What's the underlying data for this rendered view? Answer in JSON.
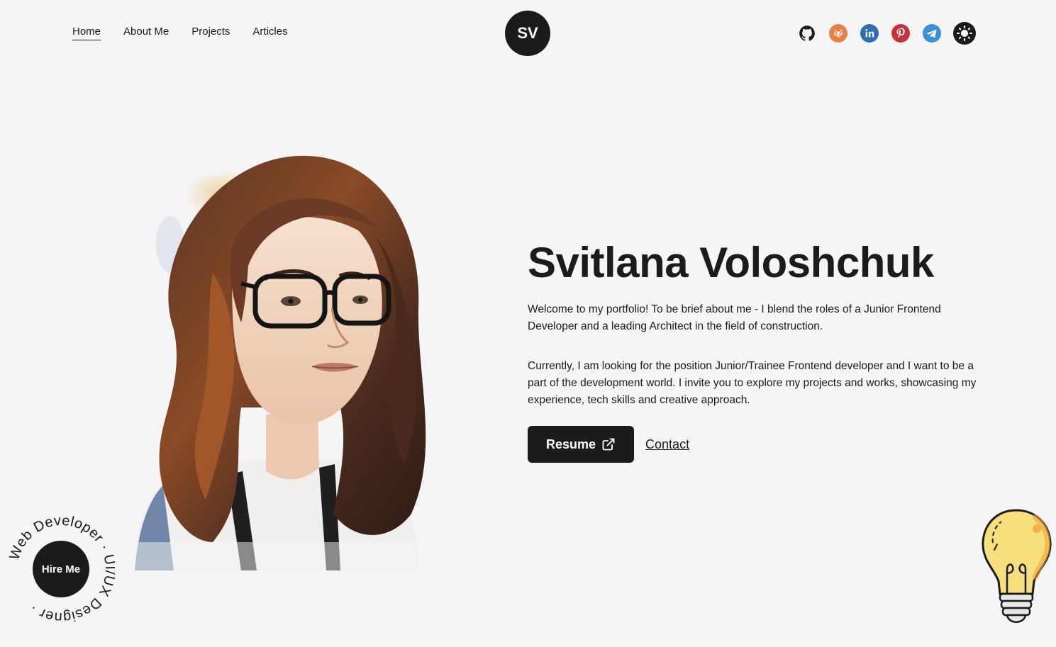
{
  "header": {
    "nav": [
      {
        "label": "Home",
        "active": true
      },
      {
        "label": "About Me",
        "active": false
      },
      {
        "label": "Projects",
        "active": false
      },
      {
        "label": "Articles",
        "active": false
      }
    ],
    "logo": "SV",
    "socials": [
      {
        "name": "github-icon",
        "color": "#1b1b1b"
      },
      {
        "name": "gitlab-icon",
        "color": "#e8804a"
      },
      {
        "name": "linkedin-icon",
        "color": "#2f6db4"
      },
      {
        "name": "pinterest-icon",
        "color": "#c8303a"
      },
      {
        "name": "telegram-icon",
        "color": "#3b8fd3"
      }
    ],
    "theme_toggle_icon": "sun-icon"
  },
  "hero": {
    "name": "Svitlana Voloshchuk",
    "intro": "Welcome to my portfolio! To be brief about me - I blend the roles of a Junior Frontend Developer and a leading Architect in the field of construction.",
    "current": "Currently, I am looking for the position Junior/Trainee Frontend developer and I want to be a part of the development world. I invite you to explore my projects and works, showcasing my experience, tech skills and creative approach.",
    "resume_label": "Resume",
    "contact_label": "Contact"
  },
  "hire": {
    "label": "Hire Me",
    "ring_text": "Web Developer · UI/UX Designer ·"
  },
  "colors": {
    "background": "#f5f5f5",
    "dark": "#1b1b1b",
    "bulb": "#f6df7c"
  }
}
